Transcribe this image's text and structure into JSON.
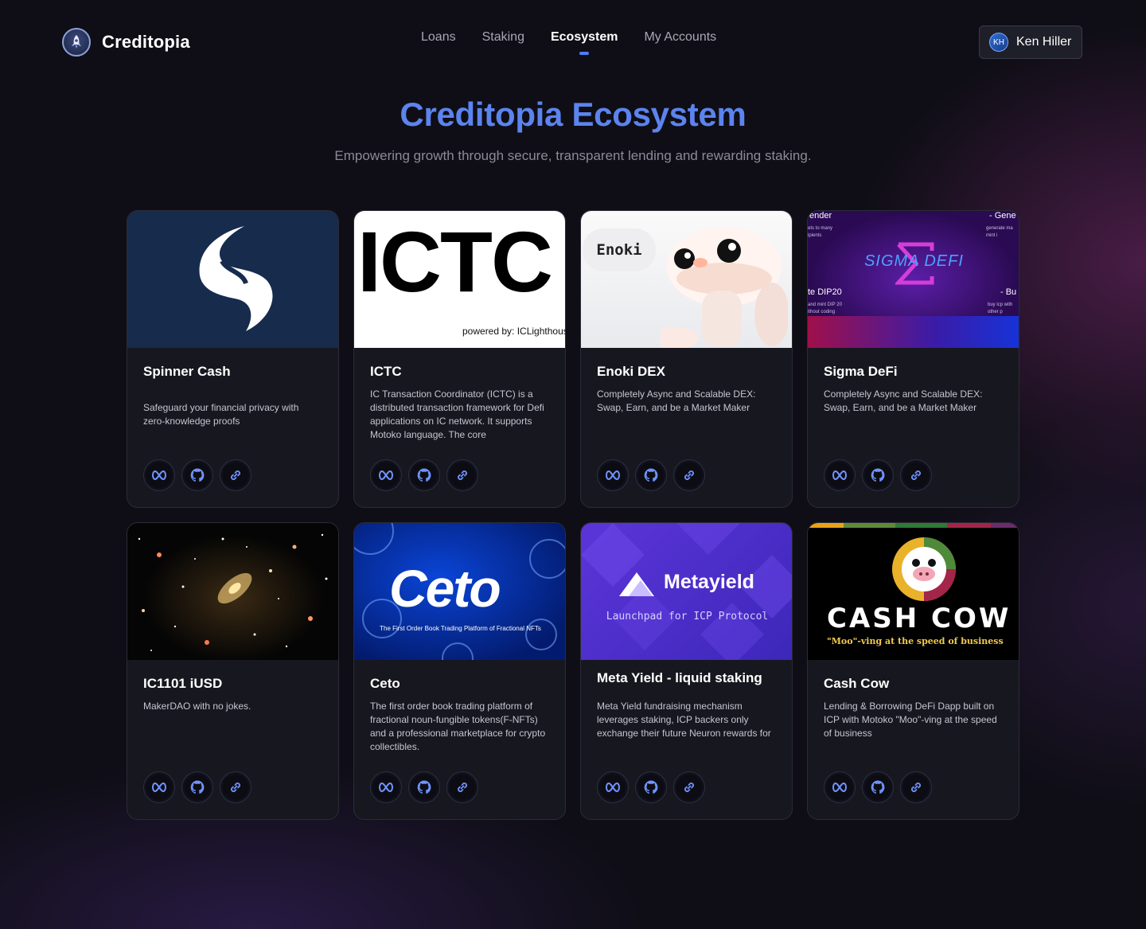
{
  "brand": {
    "name": "Creditopia"
  },
  "nav": {
    "items": [
      "Loans",
      "Staking",
      "Ecosystem",
      "My Accounts"
    ],
    "active": "Ecosystem"
  },
  "user": {
    "initials": "KH",
    "name": "Ken Hiller"
  },
  "hero": {
    "title": "Creditopia Ecosystem",
    "subtitle": "Empowering growth through secure, transparent lending and rewarding staking."
  },
  "colors": {
    "accent": "#5c84ee",
    "background": "#0f0e16",
    "card": "#17171f"
  },
  "cards": [
    {
      "title": "Spinner Cash",
      "description": "Safeguard your financial privacy with zero-knowledge proofs",
      "links": [
        "dfinity-icon",
        "github-icon",
        "link-icon"
      ]
    },
    {
      "title": "ICTC",
      "description": "IC Transaction Coordinator (ICTC) is a distributed transaction framework for Defi applications on IC network. It supports Motoko language. The core",
      "image_text": {
        "big": "ICTC",
        "small": "powered by: ICLighthous"
      },
      "links": [
        "dfinity-icon",
        "github-icon",
        "link-icon"
      ]
    },
    {
      "title": "Enoki DEX",
      "description": "Completely Async and Scalable DEX: Swap, Earn, and be a Market Maker",
      "image_text": {
        "bubble": "Enoki"
      },
      "links": [
        "dfinity-icon",
        "github-icon",
        "link-icon"
      ]
    },
    {
      "title": "Sigma DeFi",
      "description": "Completely Async and Scalable DEX: Swap, Earn, and be a Market Maker",
      "image_text": {
        "logo": "SIGMA DEFI",
        "tl": "ender",
        "tr": "- Gene",
        "ml": "te DIP20",
        "mr": "- Bu",
        "tl_small": "ets to many\nipients",
        "tr_small": "generate ma\nmint i",
        "ml_small": "and mint DIP 20\nithout coding",
        "mr_small": "buy icp with\nother p"
      },
      "links": [
        "dfinity-icon",
        "github-icon",
        "link-icon"
      ]
    },
    {
      "title": "IC1101 iUSD",
      "description": "MakerDAO with no jokes.",
      "links": [
        "dfinity-icon",
        "github-icon",
        "link-icon"
      ]
    },
    {
      "title": "Ceto",
      "description": "The first order book trading platform of fractional noun-fungible tokens(F-NFTs) and a professional marketplace for crypto collectibles.",
      "image_text": {
        "logo": "Ceto",
        "sub": "The First Order Book Trading Platform of Fractional NFTs"
      },
      "links": [
        "dfinity-icon",
        "github-icon",
        "link-icon"
      ]
    },
    {
      "title": "Meta Yield - liquid staking",
      "description": "Meta Yield fundraising mechanism leverages staking, ICP backers only exchange their future Neuron rewards for",
      "image_text": {
        "logo": "Metayield",
        "sub": "Launchpad for ICP Protocol"
      },
      "links": [
        "dfinity-icon",
        "github-icon",
        "link-icon"
      ]
    },
    {
      "title": "Cash Cow",
      "description": "Lending & Borrowing DeFi Dapp built on ICP with Motoko \"Moo\"-ving at the speed of business",
      "image_text": {
        "logo": "CASH COW",
        "sub": "\"Moo\"-ving at the speed of business"
      },
      "links": [
        "dfinity-icon",
        "github-icon",
        "link-icon"
      ]
    }
  ]
}
